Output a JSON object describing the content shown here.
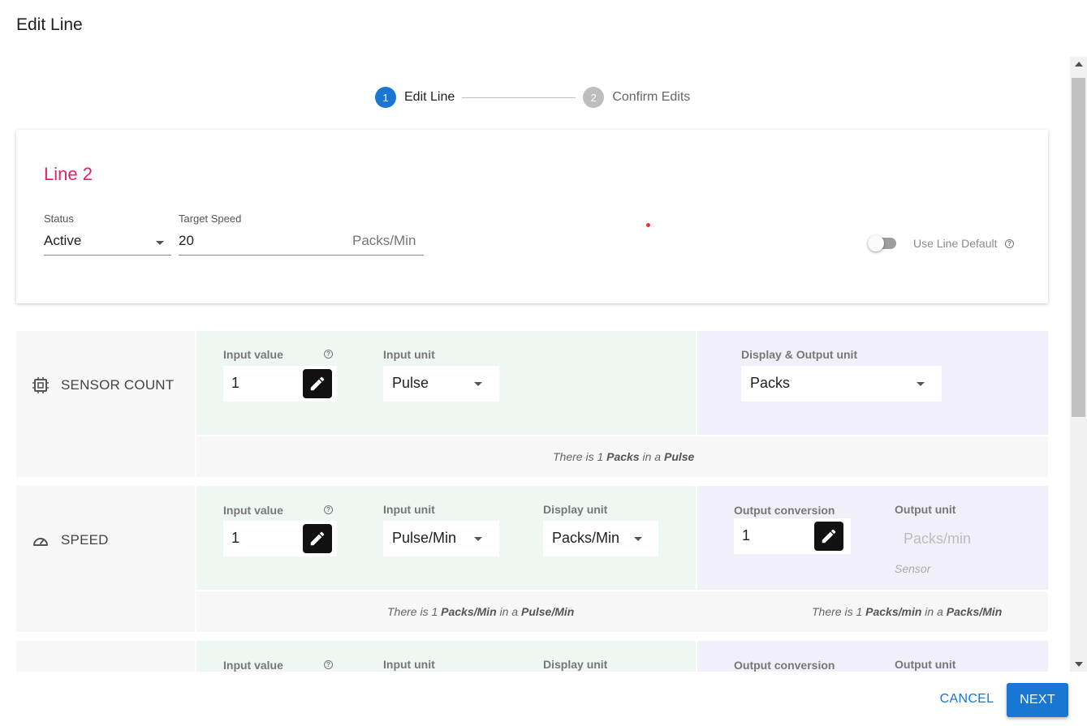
{
  "dialog": {
    "title": "Edit Line"
  },
  "stepper": {
    "steps": [
      {
        "number": "1",
        "label": "Edit Line"
      },
      {
        "number": "2",
        "label": "Confirm Edits"
      }
    ]
  },
  "line": {
    "name": "Line 2",
    "status_label": "Status",
    "status_value": "Active",
    "target_speed_label": "Target Speed",
    "target_speed_value": "20",
    "target_speed_unit": "Packs/Min",
    "use_line_default_label": "Use Line Default",
    "use_line_default_on": false
  },
  "sensor_count": {
    "name": "SENSOR COUNT",
    "input_value_label": "Input value",
    "input_value": "1",
    "input_unit_label": "Input unit",
    "input_unit": "Pulse",
    "display_output_unit_label": "Display & Output unit",
    "display_output_unit": "Packs",
    "conversion": {
      "prefix": "There is 1 ",
      "unit_a": "Packs",
      "mid": " in a ",
      "unit_b": "Pulse"
    }
  },
  "speed": {
    "name": "SPEED",
    "input_value_label": "Input value",
    "input_value": "1",
    "input_unit_label": "Input unit",
    "input_unit": "Pulse/Min",
    "display_unit_label": "Display unit",
    "display_unit": "Packs/Min",
    "output_conversion_label": "Output conversion",
    "output_conversion": "1",
    "output_unit_label": "Output unit",
    "output_unit_placeholder": "Packs/min",
    "output_unit_source": "Sensor",
    "conversion_left": {
      "prefix": "There is 1 ",
      "unit_a": "Packs/Min",
      "mid": " in a ",
      "unit_b": "Pulse/Min"
    },
    "conversion_right": {
      "prefix": "There is 1 ",
      "unit_a": "Packs/min",
      "mid": " in a ",
      "unit_b": "Packs/Min"
    }
  },
  "third_row": {
    "input_value_label": "Input value",
    "input_unit_label": "Input unit",
    "display_unit_label": "Display unit",
    "output_conversion_label": "Output conversion",
    "output_unit_label": "Output unit"
  },
  "footer": {
    "cancel_label": "CANCEL",
    "next_label": "NEXT"
  },
  "colors": {
    "primary": "#1976d2",
    "line_title": "#e0245e",
    "input_panel": "#eff7f3",
    "output_panel": "#f1f0fa"
  }
}
